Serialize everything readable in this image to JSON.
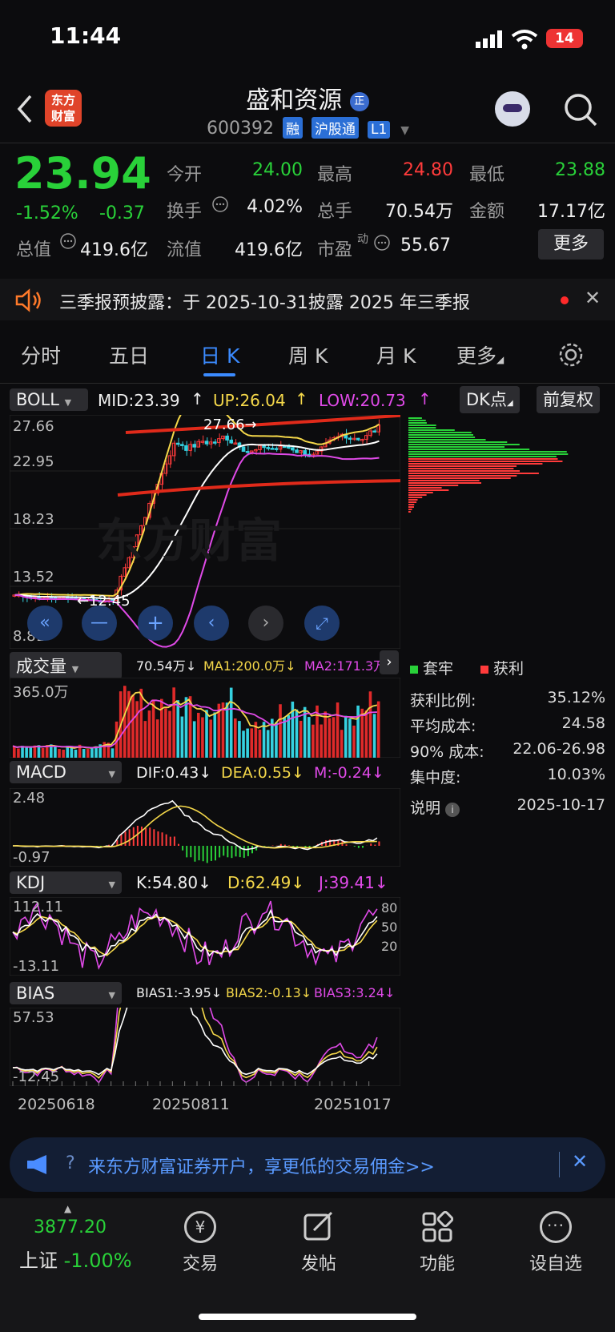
{
  "status": {
    "time": "11:44",
    "battery": "14"
  },
  "header": {
    "title": "盛和资源",
    "title_badge": "正",
    "code": "600392",
    "tags": [
      "融",
      "沪股通",
      "L1"
    ],
    "brand_logo": "东方\n财富"
  },
  "quote": {
    "price": "23.94",
    "change_pct": "-1.52%",
    "change": "-0.37",
    "fields": [
      {
        "label": "今开",
        "value": "24.00"
      },
      {
        "label": "最高",
        "value": "24.80"
      },
      {
        "label": "最低",
        "value": "23.88"
      },
      {
        "label": "换手",
        "value": "4.02%"
      },
      {
        "label": "总手",
        "value": "70.54万"
      },
      {
        "label": "金额",
        "value": "17.17亿"
      },
      {
        "label": "总值",
        "value": "419.6亿"
      },
      {
        "label": "流值",
        "value": "419.6亿"
      },
      {
        "label": "市盈",
        "value": "55.67"
      }
    ],
    "pe_sup": "动",
    "more": "更多"
  },
  "notice": {
    "text": "三季报预披露：于 2025-10-31披露 2025 年三季报"
  },
  "tabs": [
    "分时",
    "五日",
    "日 K",
    "周 K",
    "月 K",
    "更多"
  ],
  "boll": {
    "selector": "BOLL",
    "mid": "MID:23.39",
    "up": "UP:26.04",
    "low": "LOW:20.73",
    "dk_button": "DK点",
    "adj_button": "前复权",
    "y_ticks": [
      "27.66",
      "22.95",
      "18.23",
      "13.52",
      "8.81"
    ],
    "high_label": "27.66",
    "low_label": "12.45",
    "watermark": "东方财富"
  },
  "volume": {
    "selector": "成交量",
    "value": "70.54万",
    "ma1": "MA1:200.0万",
    "ma2": "MA2:171.3万",
    "y_tick": "365.0万"
  },
  "macd": {
    "selector": "MACD",
    "dif": "DIF:0.43",
    "dea": "DEA:0.55",
    "m": "M:-0.24",
    "y_ticks": [
      "2.48",
      "-0.97"
    ]
  },
  "kdj": {
    "selector": "KDJ",
    "k": "K:54.80",
    "d": "D:62.49",
    "j": "J:39.41",
    "y_ticks": [
      "112.11",
      "-13.11"
    ],
    "levels": [
      "80",
      "50",
      "20"
    ]
  },
  "bias": {
    "selector": "BIAS",
    "bias1": "BIAS1:-3.95",
    "bias2": "BIAS2:-0.13",
    "bias3": "BIAS3:3.24",
    "y_ticks": [
      "57.53",
      "-12.45"
    ]
  },
  "dates": [
    "20250618",
    "20250811",
    "20251017"
  ],
  "chip_panel": {
    "legend_trapped": "套牢",
    "legend_profit": "获利",
    "rows": [
      {
        "label": "获利比例:",
        "value": "35.12%"
      },
      {
        "label": "平均成本:",
        "value": "24.58"
      },
      {
        "label": "90% 成本:",
        "value": "22.06-26.98"
      },
      {
        "label": "集中度:",
        "value": "10.03%"
      }
    ],
    "note_label": "说明",
    "note_date": "2025-10-17"
  },
  "promo": {
    "text": "来东方财富证券开户，享更低的交易佣金>>"
  },
  "bottom_nav": {
    "index_value": "3877.20",
    "index_name": "上证",
    "index_change": "-1.00%",
    "items": [
      "交易",
      "发帖",
      "功能",
      "设自选"
    ]
  },
  "colors": {
    "up": "#ff3b3b",
    "down": "#29d139",
    "accent": "#3b8bff",
    "mid": "#ffffff",
    "upper": "#f5d84a",
    "lower": "#e04ae8"
  }
}
